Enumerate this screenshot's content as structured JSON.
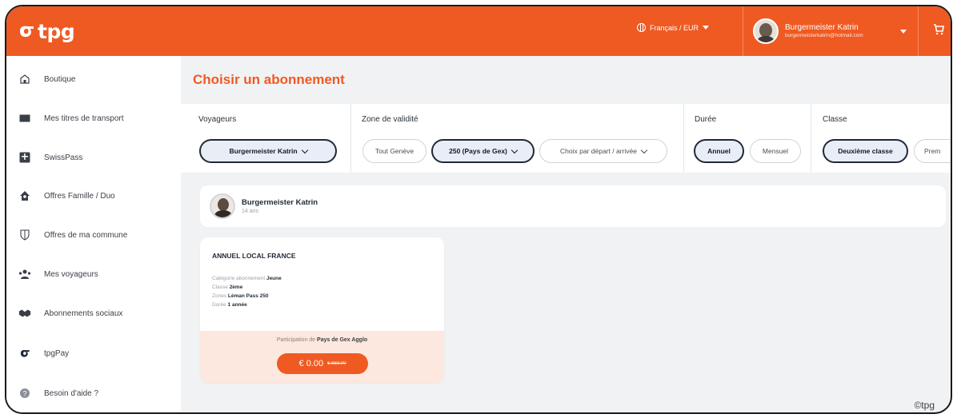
{
  "header": {
    "logo_text": "tpg",
    "language_currency": "Français / EUR",
    "user_name": "Burgermeister Katrin",
    "user_email": "burgermeisterkatrin@hotmail.com",
    "brand_color": "#ef5a22"
  },
  "sidebar": {
    "items": [
      {
        "label": "Boutique",
        "icon": "home-icon"
      },
      {
        "label": "Mes titres de transport",
        "icon": "ticket-icon"
      },
      {
        "label": "SwissPass",
        "icon": "swisspass-icon"
      },
      {
        "label": "Offres Famille / Duo",
        "icon": "family-house-icon"
      },
      {
        "label": "Offres de ma commune",
        "icon": "shield-icon"
      },
      {
        "label": "Mes voyageurs",
        "icon": "travelers-icon"
      },
      {
        "label": "Abonnements sociaux",
        "icon": "handshake-icon"
      },
      {
        "label": "tpgPay",
        "icon": "tpg-logo-icon"
      },
      {
        "label": "Besoin d'aide ?",
        "icon": "help-icon"
      }
    ]
  },
  "main": {
    "title": "Choisir un abonnement",
    "filters": {
      "travelers": {
        "label": "Voyageurs",
        "selected": "Burgermeister Katrin"
      },
      "zone": {
        "label": "Zone de validité",
        "options": [
          "Tout Genève",
          "250 (Pays de Gex)",
          "Choix par départ / arrivée"
        ],
        "selected_index": 1
      },
      "duration": {
        "label": "Durée",
        "options": [
          "Annuel",
          "Mensuel"
        ],
        "selected_index": 0
      },
      "class": {
        "label": "Classe",
        "options": [
          "Deuxième classe",
          "Prem"
        ],
        "selected_index": 0
      }
    },
    "traveler": {
      "name": "Burgermeister Katrin",
      "age": "14 ans"
    },
    "subscription": {
      "title": "ANNUEL LOCAL FRANCE",
      "details": [
        {
          "key": "Catégorie abonnement",
          "value": "Jeune"
        },
        {
          "key": "Classe",
          "value": "2ème"
        },
        {
          "key": "Zones",
          "value": "Léman Pass 250"
        },
        {
          "key": "Durée",
          "value": "1 année"
        }
      ],
      "participation_prefix": "Participation de",
      "participation_entity": "Pays de Gex Agglo",
      "price": "€ 0.00",
      "old_price": "€ 883.00"
    }
  },
  "footer": {
    "copyright": "©tpg"
  }
}
